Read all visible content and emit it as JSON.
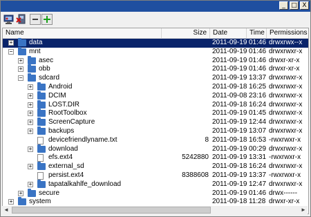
{
  "window": {
    "minimize_label": "_",
    "maximize_label": "□",
    "close_label": "X"
  },
  "toolbar": {
    "buttons": [
      {
        "icon": "computer-icon"
      },
      {
        "icon": "delete-device-icon"
      },
      {
        "icon": "collapse-icon",
        "label": "−"
      },
      {
        "icon": "expand-icon",
        "label": "+"
      }
    ]
  },
  "columns": {
    "name": "Name",
    "size": "Size",
    "date": "Date",
    "time": "Time",
    "perms": "Permissions"
  },
  "rows": [
    {
      "name": "data",
      "size": "",
      "date": "2011-09-19",
      "time": "01:46",
      "perms": "drwxrwx--x",
      "type": "folder",
      "level": 0,
      "expander": "+",
      "selected": true
    },
    {
      "name": "mnt",
      "size": "",
      "date": "2011-09-19",
      "time": "01:46",
      "perms": "drwxrwxr-x",
      "type": "folder",
      "level": 0,
      "expander": "−"
    },
    {
      "name": "asec",
      "size": "",
      "date": "2011-09-19",
      "time": "01:46",
      "perms": "drwxr-xr-x",
      "type": "folder",
      "level": 1,
      "expander": "+"
    },
    {
      "name": "obb",
      "size": "",
      "date": "2011-09-19",
      "time": "01:46",
      "perms": "drwxr-xr-x",
      "type": "folder",
      "level": 1,
      "expander": "+"
    },
    {
      "name": "sdcard",
      "size": "",
      "date": "2011-09-19",
      "time": "13:37",
      "perms": "drwxrwxr-x",
      "type": "folder",
      "level": 1,
      "expander": "−"
    },
    {
      "name": "Android",
      "size": "",
      "date": "2011-09-18",
      "time": "16:25",
      "perms": "drwxrwxr-x",
      "type": "folder",
      "level": 2,
      "expander": "+"
    },
    {
      "name": "DCIM",
      "size": "",
      "date": "2011-09-08",
      "time": "23:16",
      "perms": "drwxrwxr-x",
      "type": "folder",
      "level": 2,
      "expander": "+"
    },
    {
      "name": "LOST.DIR",
      "size": "",
      "date": "2011-09-18",
      "time": "16:24",
      "perms": "drwxrwxr-x",
      "type": "folder",
      "level": 2,
      "expander": "+"
    },
    {
      "name": "RootToolbox",
      "size": "",
      "date": "2011-09-19",
      "time": "01:45",
      "perms": "drwxrwxr-x",
      "type": "folder",
      "level": 2,
      "expander": "+"
    },
    {
      "name": "ScreenCapture",
      "size": "",
      "date": "2011-09-19",
      "time": "12:44",
      "perms": "drwxrwxr-x",
      "type": "folder",
      "level": 2,
      "expander": "+"
    },
    {
      "name": "backups",
      "size": "",
      "date": "2011-09-19",
      "time": "13:07",
      "perms": "drwxrwxr-x",
      "type": "folder",
      "level": 2,
      "expander": "+"
    },
    {
      "name": "devicefriendlyname.txt",
      "size": "8",
      "date": "2011-09-18",
      "time": "16:53",
      "perms": "-rwxrwxr-x",
      "type": "file",
      "level": 2,
      "expander": ""
    },
    {
      "name": "download",
      "size": "",
      "date": "2011-09-19",
      "time": "00:29",
      "perms": "drwxrwxr-x",
      "type": "folder",
      "level": 2,
      "expander": "+"
    },
    {
      "name": "efs.ext4",
      "size": "5242880",
      "date": "2011-09-19",
      "time": "13:31",
      "perms": "-rwxrwxr-x",
      "type": "file",
      "level": 2,
      "expander": ""
    },
    {
      "name": "external_sd",
      "size": "",
      "date": "2011-09-18",
      "time": "16:24",
      "perms": "drwxrwxr-x",
      "type": "folder",
      "level": 2,
      "expander": "+"
    },
    {
      "name": "persist.ext4",
      "size": "8388608",
      "date": "2011-09-19",
      "time": "13:37",
      "perms": "-rwxrwxr-x",
      "type": "file",
      "level": 2,
      "expander": ""
    },
    {
      "name": "tapatalkahlfe_download",
      "size": "",
      "date": "2011-09-19",
      "time": "12:47",
      "perms": "drwxrwxr-x",
      "type": "folder",
      "level": 2,
      "expander": "+"
    },
    {
      "name": "secure",
      "size": "",
      "date": "2011-09-19",
      "time": "01:46",
      "perms": "drwx------",
      "type": "folder",
      "level": 1,
      "expander": "+"
    },
    {
      "name": "system",
      "size": "",
      "date": "2011-09-18",
      "time": "11:28",
      "perms": "drwxr-xr-x",
      "type": "folder",
      "level": 0,
      "expander": "+"
    }
  ],
  "scroll": {
    "left_arrow": "◄",
    "right_arrow": "►"
  }
}
